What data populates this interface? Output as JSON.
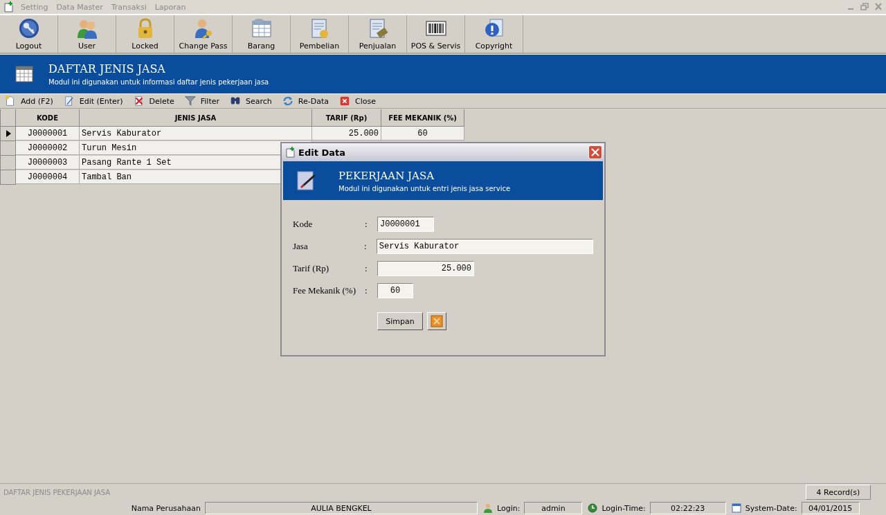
{
  "menu": [
    {
      "label": "Setting",
      "disabled": true
    },
    {
      "label": "Data Master",
      "disabled": true
    },
    {
      "label": "Transaksi",
      "disabled": true
    },
    {
      "label": "Laporan",
      "disabled": true
    }
  ],
  "toolbar": [
    {
      "label": "Logout",
      "kind": "key"
    },
    {
      "label": "User",
      "kind": "users"
    },
    {
      "label": "Locked",
      "kind": "lock"
    },
    {
      "label": "Change Pass",
      "kind": "userkey"
    },
    {
      "label": "Barang",
      "kind": "table"
    },
    {
      "label": "Pembelian",
      "kind": "buy"
    },
    {
      "label": "Penjualan",
      "kind": "sell"
    },
    {
      "label": "POS & Servis",
      "kind": "barcode"
    },
    {
      "label": "Copyright",
      "kind": "info"
    }
  ],
  "header": {
    "title": "DAFTAR JENIS JASA",
    "subtitle": "Modul ini digunakan untuk informasi daftar jenis pekerjaan jasa"
  },
  "actions": [
    {
      "label": "Add (F2)",
      "kind": "add"
    },
    {
      "label": "Edit (Enter)",
      "kind": "edit"
    },
    {
      "label": "Delete",
      "kind": "delete"
    },
    {
      "label": "Filter",
      "kind": "filter"
    },
    {
      "label": "Search",
      "kind": "search"
    },
    {
      "label": "Re-Data",
      "kind": "refresh"
    },
    {
      "label": "Close",
      "kind": "close"
    }
  ],
  "table": {
    "columns": [
      "KODE",
      "JENIS JASA",
      "TARIF (Rp)",
      "FEE MEKANIK (%)"
    ],
    "rows": [
      {
        "selected": true,
        "kode": "J0000001",
        "jasa": "Servis Kaburator",
        "tarif": "25.000",
        "fee": "60"
      },
      {
        "selected": false,
        "kode": "J0000002",
        "jasa": "Turun Mesin"
      },
      {
        "selected": false,
        "kode": "J0000003",
        "jasa": "Pasang Rante 1 Set"
      },
      {
        "selected": false,
        "kode": "J0000004",
        "jasa": "Tambal Ban"
      }
    ]
  },
  "dialog": {
    "title": "Edit Data",
    "header_title": "PEKERJAAN JASA",
    "header_subtitle": "Modul ini digunakan untuk entri jenis jasa service",
    "fields": [
      {
        "label": "Kode",
        "colon": ":",
        "value": "J0000001",
        "kind": "short"
      },
      {
        "label": "Jasa",
        "colon": ":",
        "value": "Servis Kaburator",
        "kind": "wide"
      },
      {
        "label": "Tarif (Rp)",
        "colon": ":",
        "value": "25.000",
        "kind": "number"
      },
      {
        "label": "Fee Mekanik (%)",
        "colon": ":",
        "value": "60",
        "kind": "tiny"
      }
    ],
    "save_button": "Simpan"
  },
  "status": {
    "caption": "DAFTAR JENIS PEKERJAAN JASA",
    "records": "4 Record(s)",
    "company_label": "Nama Perusahaan",
    "company": "AULIA BENGKEL",
    "login_label": "Login:",
    "login": "admin",
    "time_label": "Login-Time:",
    "time": "02:22:23",
    "date_label": "System-Date:",
    "date": "04/01/2015"
  }
}
